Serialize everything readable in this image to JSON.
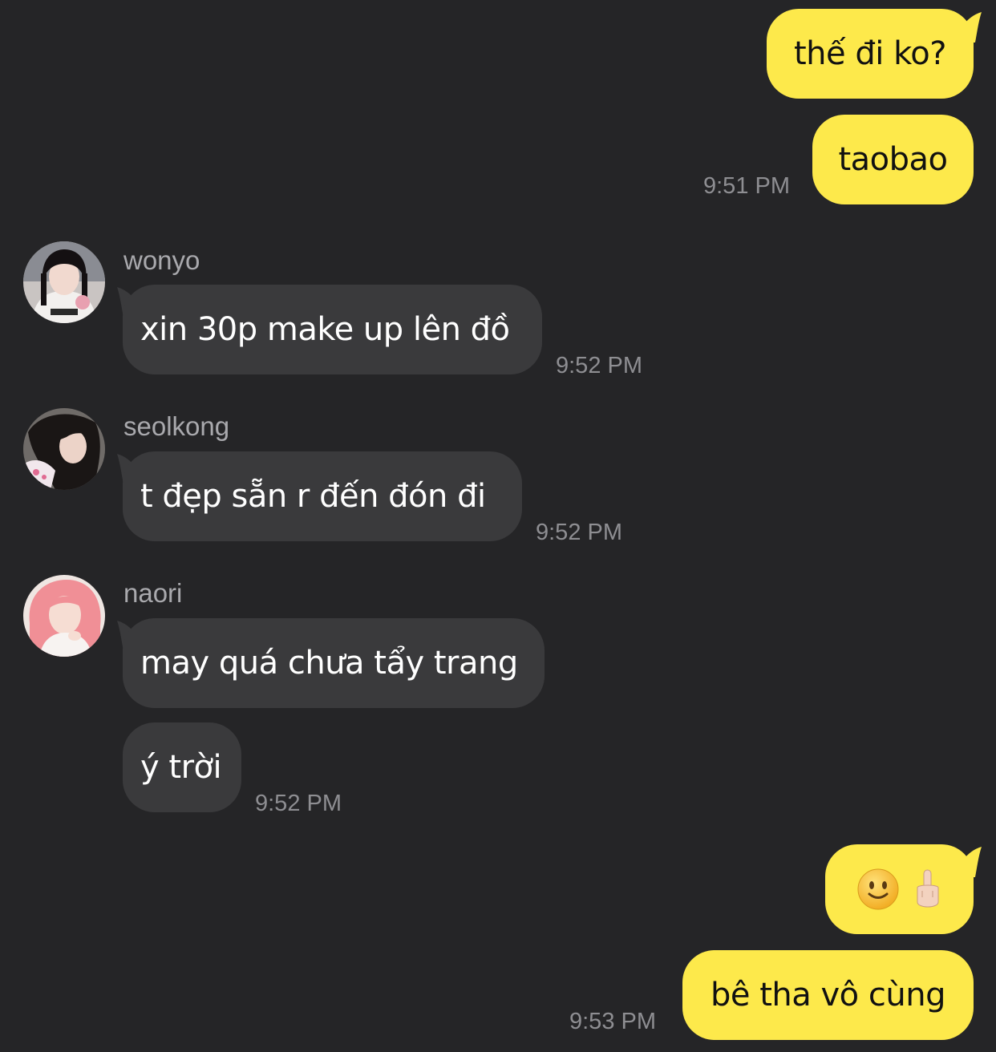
{
  "colors": {
    "background": "#252527",
    "outgoing_bubble": "#fde94b",
    "incoming_bubble": "#3a3a3c",
    "timestamp": "#8e8e92",
    "sender_name": "#a9a9ad"
  },
  "messages": {
    "m1": {
      "text": "thế đi ko?"
    },
    "m2": {
      "text": "taobao",
      "time": "9:51 PM"
    },
    "m3": {
      "sender": "wonyo",
      "text": "xin 30p make up lên đồ",
      "time": "9:52 PM"
    },
    "m4": {
      "sender": "seolkong",
      "text": "t đẹp sẵn r đến đón đi",
      "time": "9:52 PM"
    },
    "m5": {
      "sender": "naori",
      "text": "may quá chưa tẩy trang"
    },
    "m6": {
      "text": "ý trời",
      "time": "9:52 PM"
    },
    "m7": {
      "emoji": [
        "slightly-smiling-face",
        "middle-finger"
      ]
    },
    "m8": {
      "text": "bê tha vô cùng",
      "time": "9:53 PM"
    }
  }
}
